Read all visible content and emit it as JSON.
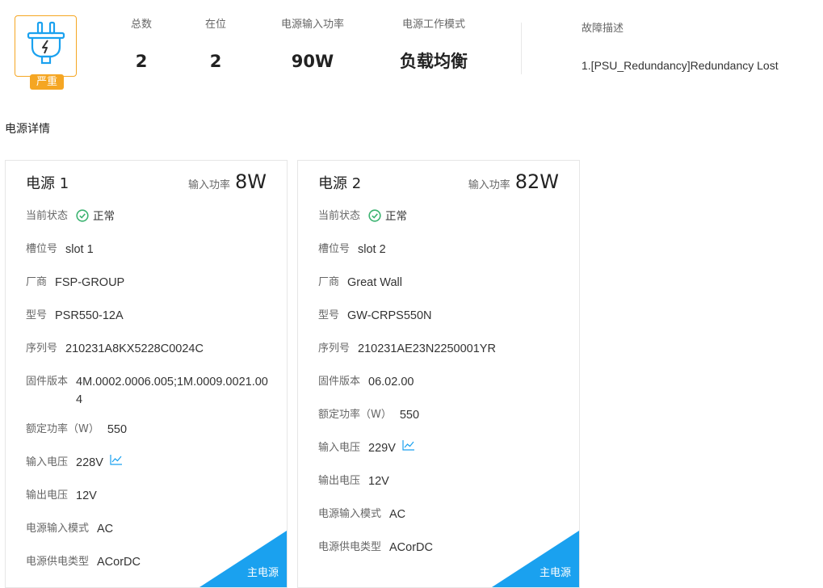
{
  "summary": {
    "severity": "严重",
    "icon": "power-plug-icon",
    "stats": [
      {
        "label": "总数",
        "value": "2"
      },
      {
        "label": "在位",
        "value": "2"
      },
      {
        "label": "电源输入功率",
        "value": "90W"
      },
      {
        "label": "电源工作模式",
        "value": "负载均衡"
      }
    ],
    "fault_title": "故障描述",
    "fault_desc": "1.[PSU_Redundancy]Redundancy Lost"
  },
  "section_title": "电源详情",
  "colors": {
    "accent": "#1aa1ef",
    "warning": "#f5a623",
    "ok": "#3cb371"
  },
  "cards": [
    {
      "title": "电源 1",
      "power_label": "输入功率",
      "power_value": "8W",
      "status_label": "当前状态",
      "status_value": "正常",
      "slot_label": "槽位号",
      "slot_value": "slot 1",
      "vendor_label": "厂商",
      "vendor_value": "FSP-GROUP",
      "model_label": "型号",
      "model_value": "PSR550-12A",
      "serial_label": "序列号",
      "serial_value": "210231A8KX5228C0024C",
      "firmware_label": "固件版本",
      "firmware_value": "4M.0002.0006.005;1M.0009.0021.004",
      "rated_label": "额定功率（W）",
      "rated_value": "550",
      "vin_label": "输入电压",
      "vin_value": "228V",
      "vout_label": "输出电压",
      "vout_value": "12V",
      "input_mode_label": "电源输入模式",
      "input_mode_value": "AC",
      "supply_type_label": "电源供电类型",
      "supply_type_value": "ACorDC",
      "corner_label": "主电源"
    },
    {
      "title": "电源 2",
      "power_label": "输入功率",
      "power_value": "82W",
      "status_label": "当前状态",
      "status_value": "正常",
      "slot_label": "槽位号",
      "slot_value": "slot 2",
      "vendor_label": "厂商",
      "vendor_value": "Great Wall",
      "model_label": "型号",
      "model_value": "GW-CRPS550N",
      "serial_label": "序列号",
      "serial_value": "210231AE23N2250001YR",
      "firmware_label": "固件版本",
      "firmware_value": "06.02.00",
      "rated_label": "额定功率（W）",
      "rated_value": "550",
      "vin_label": "输入电压",
      "vin_value": "229V",
      "vout_label": "输出电压",
      "vout_value": "12V",
      "input_mode_label": "电源输入模式",
      "input_mode_value": "AC",
      "supply_type_label": "电源供电类型",
      "supply_type_value": "ACorDC",
      "corner_label": "主电源"
    }
  ]
}
